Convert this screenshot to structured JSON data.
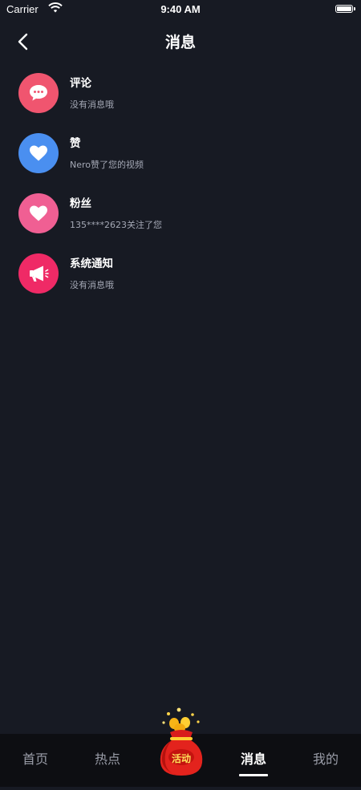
{
  "status_bar": {
    "carrier": "Carrier",
    "time": "9:40 AM"
  },
  "nav": {
    "title": "消息",
    "back_icon": "chevron-left-icon"
  },
  "messages": [
    {
      "title": "评论",
      "subtitle": "没有消息哦",
      "icon": "comment-bubble-icon",
      "color": "#f0556f"
    },
    {
      "title": "赞",
      "subtitle": "Nero赞了您的视频",
      "icon": "heart-icon",
      "color": "#4a8ff0"
    },
    {
      "title": "粉丝",
      "subtitle": "135****2623关注了您",
      "icon": "heart-icon",
      "color": "#f05f93"
    },
    {
      "title": "系统通知",
      "subtitle": "没有消息哦",
      "icon": "megaphone-icon",
      "color": "#ef2a66"
    }
  ],
  "tab_bar": {
    "tabs": [
      {
        "label": "首页",
        "active": false
      },
      {
        "label": "热点",
        "active": false
      },
      {
        "label": "消息",
        "active": true
      },
      {
        "label": "我的",
        "active": false
      }
    ],
    "center": {
      "label": "活动",
      "icon": "lucky-bag-icon"
    }
  },
  "colors": {
    "background": "#171a23",
    "tab_bar": "#0d0e12",
    "subtitle": "#a4a8b5"
  }
}
